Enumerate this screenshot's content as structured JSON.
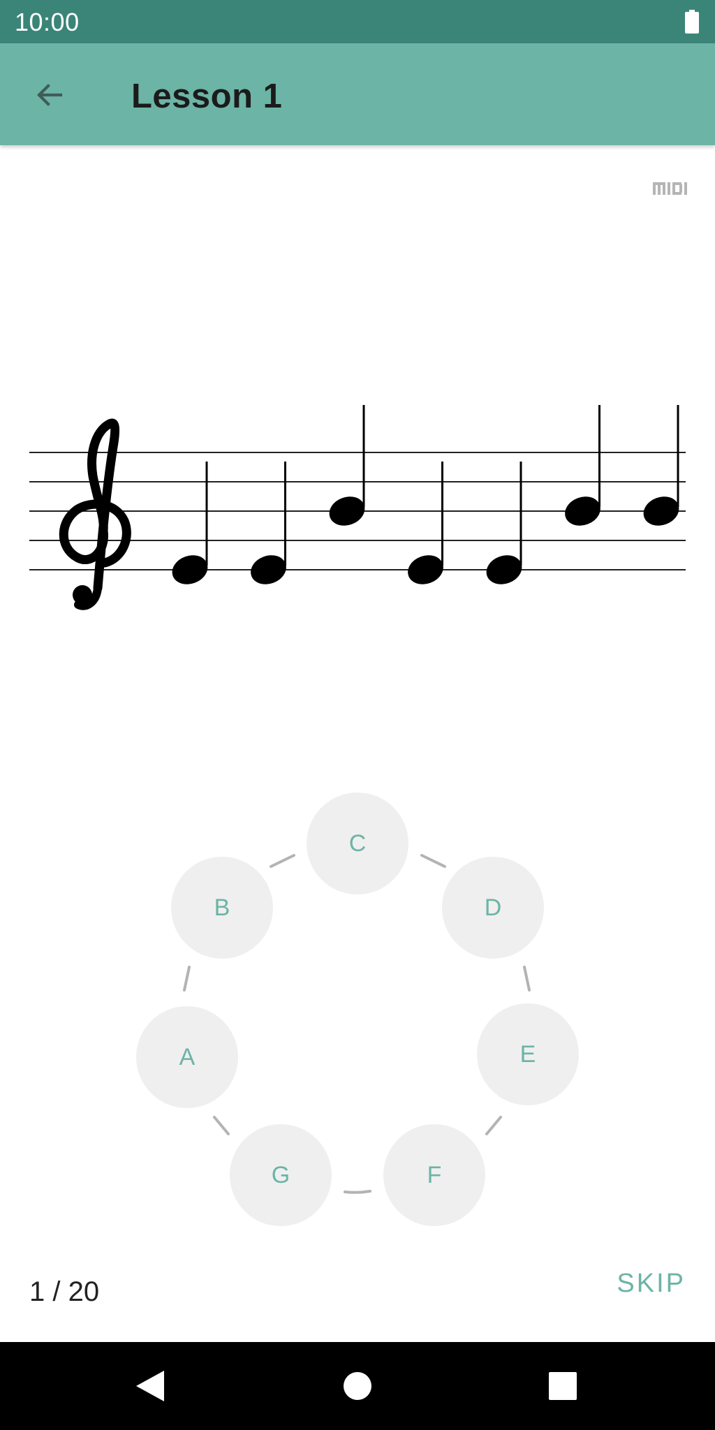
{
  "status_bar": {
    "time": "10:00"
  },
  "app_bar": {
    "title": "Lesson 1",
    "back_icon": "arrow-back-icon"
  },
  "top_right_icon": "midi-icon",
  "staff": {
    "clef": "treble",
    "notes": [
      "E",
      "E",
      "B",
      "E",
      "E",
      "B",
      "B"
    ]
  },
  "note_circle": {
    "options": [
      "C",
      "D",
      "E",
      "F",
      "G",
      "A",
      "B"
    ]
  },
  "footer": {
    "progress": "1 / 20",
    "skip_label": "SKIP"
  },
  "colors": {
    "status_bar": "#3b8578",
    "app_bar": "#6cb4a6",
    "accent": "#6cb4a6",
    "button_bg": "#efefef"
  },
  "nav_bar": {
    "buttons": [
      "back-icon",
      "home-icon",
      "recents-icon"
    ]
  }
}
